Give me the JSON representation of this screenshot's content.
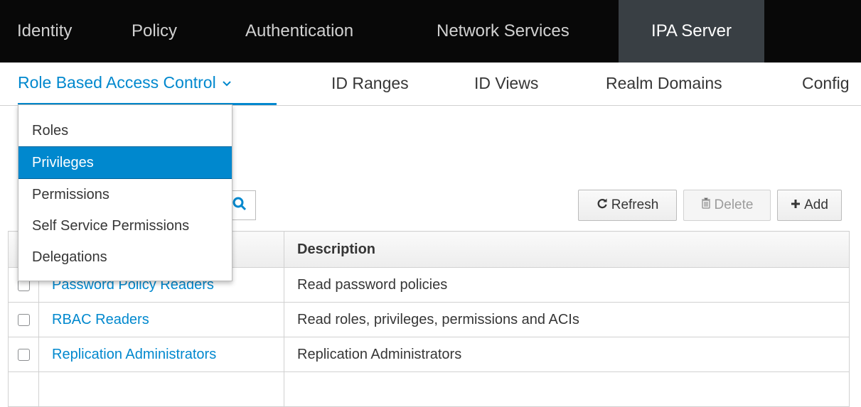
{
  "topnav": {
    "items": [
      {
        "label": "Identity"
      },
      {
        "label": "Policy"
      },
      {
        "label": "Authentication"
      },
      {
        "label": "Network Services"
      },
      {
        "label": "IPA Server",
        "active": true
      }
    ]
  },
  "subnav": {
    "items": [
      {
        "label": "Role Based Access Control",
        "active": true,
        "has_dropdown": true
      },
      {
        "label": "ID Ranges"
      },
      {
        "label": "ID Views"
      },
      {
        "label": "Realm Domains"
      },
      {
        "label": "Config"
      }
    ]
  },
  "dropdown": {
    "items": [
      {
        "label": "Roles"
      },
      {
        "label": "Privileges",
        "selected": true
      },
      {
        "label": "Permissions"
      },
      {
        "label": "Self Service Permissions"
      },
      {
        "label": "Delegations"
      }
    ]
  },
  "toolbar": {
    "search_icon": "search-icon",
    "refresh_label": "Refresh",
    "delete_label": "Delete",
    "add_label": "Add"
  },
  "table": {
    "columns": [
      "",
      "Description"
    ],
    "rows": [
      {
        "name": "Password Policy Readers",
        "description": "Read password policies"
      },
      {
        "name": "RBAC Readers",
        "description": "Read roles, privileges, permissions and ACIs"
      },
      {
        "name": "Replication Administrators",
        "description": "Replication Administrators"
      },
      {
        "name": "",
        "description": ""
      }
    ]
  },
  "colors": {
    "accent": "#0088ce",
    "topnav_bg": "#080808",
    "topnav_active_bg": "#393f44"
  }
}
